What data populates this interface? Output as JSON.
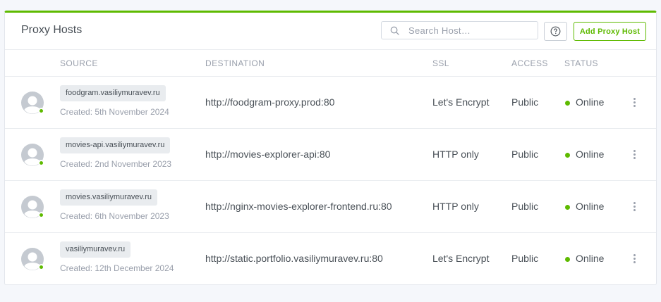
{
  "header": {
    "title": "Proxy Hosts",
    "search_placeholder": "Search Host…",
    "help_icon": "question-circle-icon",
    "add_label": "Add Proxy Host"
  },
  "columns": {
    "source": "SOURCE",
    "destination": "DESTINATION",
    "ssl": "SSL",
    "access": "ACCESS",
    "status": "STATUS"
  },
  "colors": {
    "accent": "#5eba00",
    "muted": "#9aa0ac",
    "text": "#495057",
    "tag_bg": "#e9ecef"
  },
  "hosts": [
    {
      "domain": "foodgram.vasiliymuravev.ru",
      "created": "Created: 5th November 2024",
      "destination": "http://foodgram-proxy.prod:80",
      "ssl": "Let's Encrypt",
      "access": "Public",
      "status": "Online"
    },
    {
      "domain": "movies-api.vasiliymuravev.ru",
      "created": "Created: 2nd November 2023",
      "destination": "http://movies-explorer-api:80",
      "ssl": "HTTP only",
      "access": "Public",
      "status": "Online"
    },
    {
      "domain": "movies.vasiliymuravev.ru",
      "created": "Created: 6th November 2023",
      "destination": "http://nginx-movies-explorer-frontend.ru:80",
      "ssl": "HTTP only",
      "access": "Public",
      "status": "Online"
    },
    {
      "domain": "vasiliymuravev.ru",
      "created": "Created: 12th December 2024",
      "destination": "http://static.portfolio.vasiliymuravev.ru:80",
      "ssl": "Let's Encrypt",
      "access": "Public",
      "status": "Online"
    }
  ]
}
